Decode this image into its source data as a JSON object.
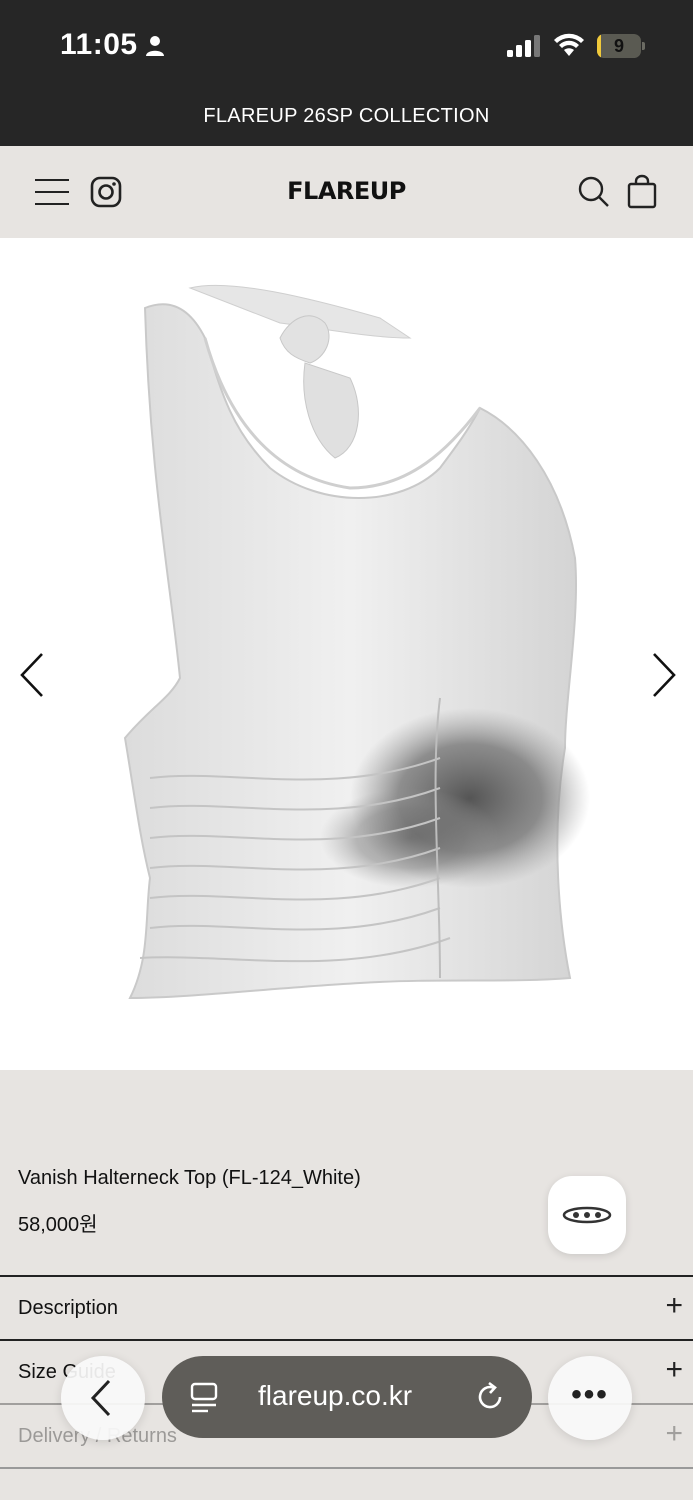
{
  "status_bar": {
    "time": "11:05",
    "battery_level": "9",
    "battery_fraction": 0.09
  },
  "announcement": {
    "text": "FLAREUP 26SP COLLECTION"
  },
  "header": {
    "logo": "FLAREUP"
  },
  "product": {
    "title": "Vanish Halterneck Top (FL-124_White)",
    "price": "58,000원"
  },
  "accordions": [
    {
      "label": "Description"
    },
    {
      "label": "Size Guide"
    },
    {
      "label": "Delivery / Returns"
    }
  ],
  "browser": {
    "url": "flareup.co.kr"
  },
  "colors": {
    "dark_bar": "#262626",
    "page_bg": "#e7e4e1",
    "battery_accent": "#f0c93a"
  }
}
